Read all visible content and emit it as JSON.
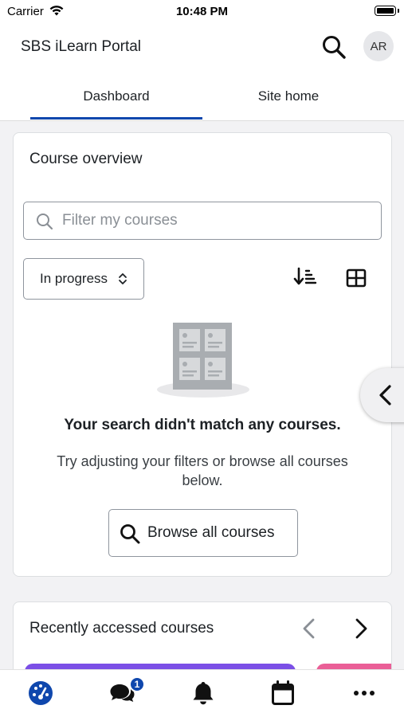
{
  "status_bar": {
    "carrier": "Carrier",
    "time": "10:48 PM"
  },
  "app_bar": {
    "title": "SBS iLearn Portal",
    "avatar_initials": "AR",
    "search_icon": "search-icon"
  },
  "tabs": [
    {
      "label": "Dashboard",
      "active": true
    },
    {
      "label": "Site home",
      "active": false
    }
  ],
  "course_overview": {
    "title": "Course overview",
    "filter_placeholder": "Filter my courses",
    "filter_value": "",
    "status_filter": "In progress",
    "empty_title": "Your search didn't match any courses.",
    "empty_body": "Try adjusting your filters or browse all courses below.",
    "browse_button": "Browse all courses"
  },
  "recent_courses": {
    "title": "Recently accessed courses"
  },
  "bottom_nav": {
    "items": [
      {
        "icon": "dashboard-gauge-icon",
        "active": true
      },
      {
        "icon": "messages-icon",
        "badge": "1"
      },
      {
        "icon": "bell-icon"
      },
      {
        "icon": "calendar-icon"
      },
      {
        "icon": "more-icon"
      }
    ]
  },
  "colors": {
    "primary": "#0f47ad",
    "course_card_1": "#7b4fe6",
    "course_card_2": "#ea5f97"
  }
}
